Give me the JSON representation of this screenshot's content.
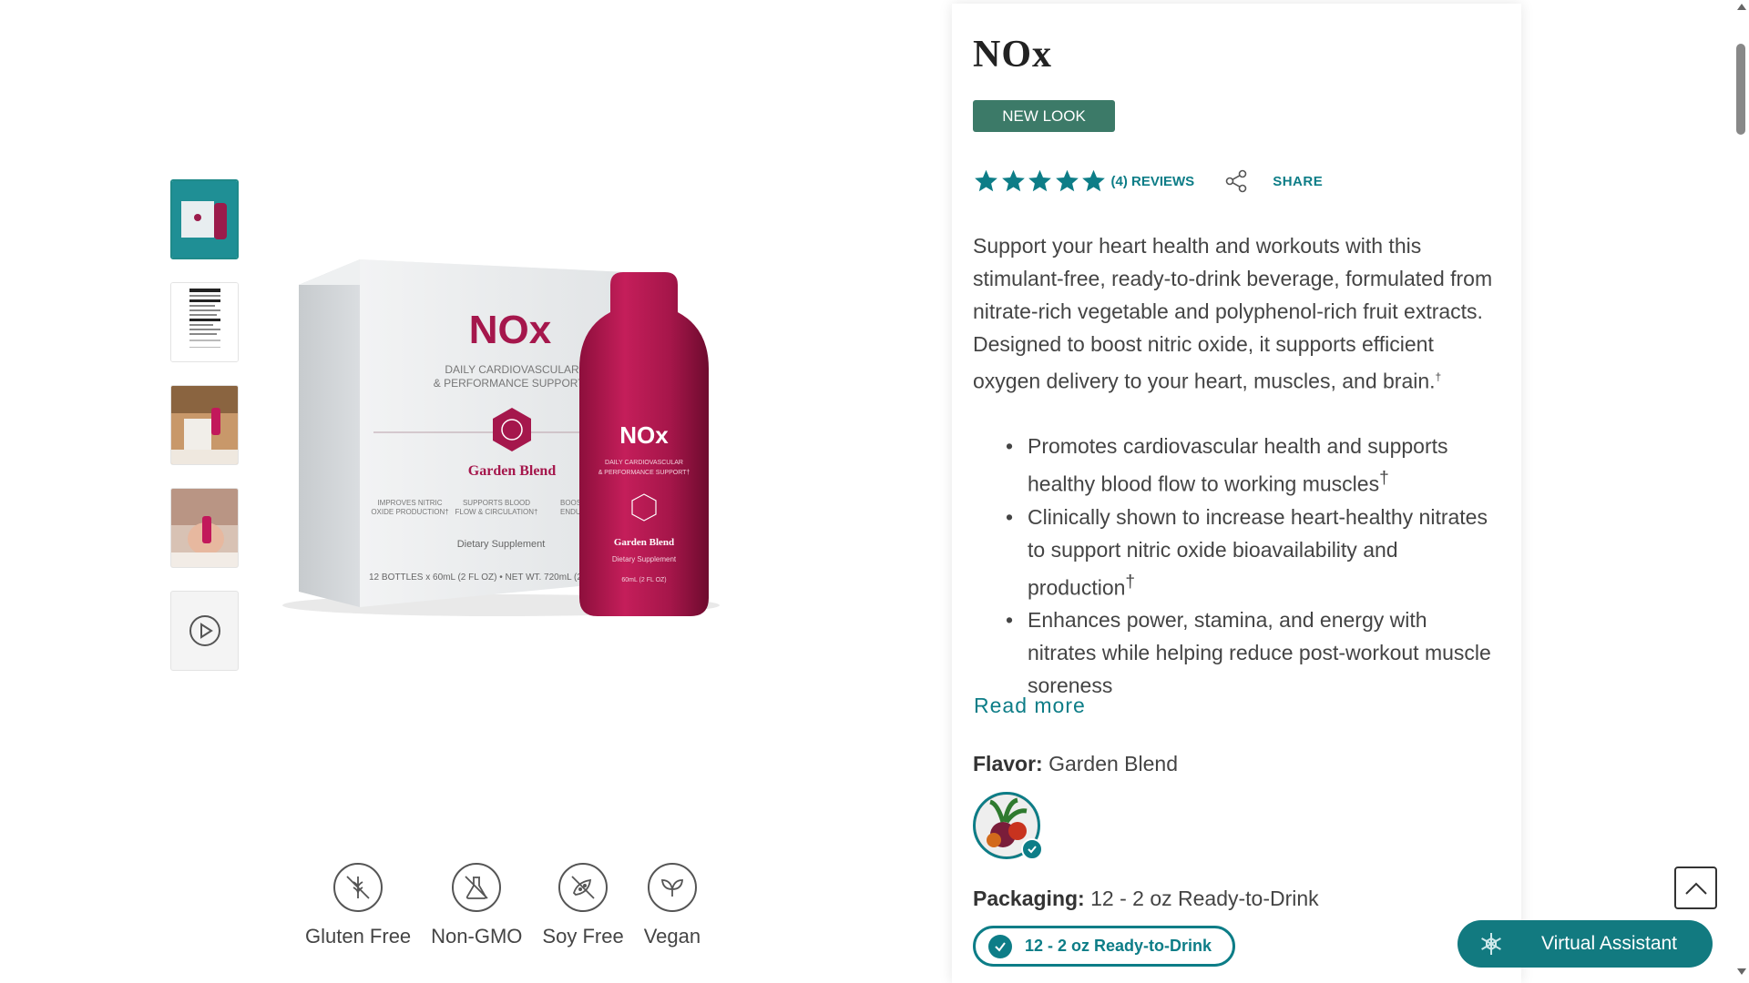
{
  "product": {
    "title": "NOx",
    "badge": "NEW LOOK",
    "rating_stars": 5,
    "reviews_label": "(4) REVIEWS",
    "share_label": "SHARE",
    "description": "Support your heart health and workouts with this stimulant-free, ready-to-drink beverage, formulated from nitrate-rich vegetable and polyphenol-rich fruit extracts. Designed to boost nitric oxide, it supports efficient oxygen delivery to your heart, muscles, and brain.",
    "dagger": "†",
    "bullets": [
      "Promotes cardiovascular health and supports healthy blood flow to working muscles",
      "Clinically shown to increase heart-healthy nitrates to support nitric oxide bioavailability and production",
      "Enhances power, stamina, and energy with nitrates while helping reduce post-workout muscle soreness"
    ],
    "read_more": "Read more",
    "flavor_label": "Flavor:",
    "flavor_value": "Garden Blend",
    "packaging_label": "Packaging:",
    "packaging_value": "12 - 2 oz Ready-to-Drink",
    "packaging_option": "12 - 2 oz Ready-to-Drink"
  },
  "image": {
    "box_brand": "NOx",
    "box_subtitle_1": "DAILY CARDIOVASCULAR",
    "box_subtitle_2": "& PERFORMANCE SUPPORT†",
    "box_flavor": "Garden Blend",
    "box_claim_1a": "IMPROVES NITRIC",
    "box_claim_1b": "OXIDE PRODUCTION†",
    "box_claim_2a": "SUPPORTS BLOOD",
    "box_claim_2b": "FLOW & CIRCULATION†",
    "box_claim_3a": "BOOSTS M",
    "box_claim_3b": "ENDURA",
    "box_supplement": "Dietary Supplement",
    "box_net": "12 BOTTLES x 60mL (2 FL OZ) • NET WT. 720mL (24",
    "bottle_brand": "NOx",
    "bottle_sub_1": "DAILY CARDIOVASCULAR",
    "bottle_sub_2": "& PERFORMANCE SUPPORT†",
    "bottle_flavor": "Garden Blend",
    "bottle_supplement": "Dietary Supplement",
    "bottle_volume": "60mL (2 FL OZ)"
  },
  "thumbnails": [
    "product-box-thumb",
    "nutrition-facts-thumb",
    "lifestyle-thumb-1",
    "lifestyle-thumb-2",
    "video-thumb"
  ],
  "badges": [
    {
      "label": "Gluten Free",
      "icon": "gluten-free-icon"
    },
    {
      "label": "Non-GMO",
      "icon": "non-gmo-icon"
    },
    {
      "label": "Soy Free",
      "icon": "soy-free-icon"
    },
    {
      "label": "Vegan",
      "icon": "vegan-icon"
    }
  ],
  "assistant": {
    "label": "Virtual Assistant"
  },
  "colors": {
    "accent": "#0d7d87",
    "badge_bg": "#3c7a68",
    "product": "#b0144f"
  }
}
